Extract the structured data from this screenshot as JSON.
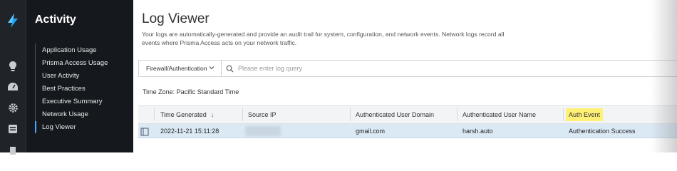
{
  "rail": {
    "icons": [
      "logo-icon",
      "lightbulb-icon",
      "dashboard-icon",
      "gear-icon",
      "activity-icon",
      "doc-icon"
    ]
  },
  "panel": {
    "title": "Activity",
    "items": [
      {
        "label": "Application Usage"
      },
      {
        "label": "Prisma Access Usage"
      },
      {
        "label": "User Activity"
      },
      {
        "label": "Best Practices"
      },
      {
        "label": "Executive Summary"
      },
      {
        "label": "Network Usage"
      },
      {
        "label": "Log Viewer"
      }
    ],
    "active_index": 6
  },
  "main": {
    "title": "Log Viewer",
    "description": "Your logs are automatically-generated and provide an audit trail for system, configuration, and network events. Network logs record all events where Prisma Access acts on your network traffic.",
    "filter": {
      "select_value": "Firewall/Authentication",
      "query_placeholder": "Please enter log query"
    },
    "timezone": "Time Zone: Pacific Standard Time"
  },
  "table": {
    "columns": [
      "Time Generated",
      "Source IP",
      "Authenticated User Domain",
      "Authenticated User Name",
      "Auth Event"
    ],
    "rows": [
      {
        "time": "2022-11-21 15:11:28",
        "source_ip": "",
        "domain": "gmail.com",
        "user": "harsh.auto",
        "event": "Authentication Success"
      }
    ]
  },
  "colors": {
    "accent": "#4aa6ff",
    "highlight": "#fff176",
    "selected_row": "#dbe9f5",
    "sidebar": "#15191d"
  }
}
